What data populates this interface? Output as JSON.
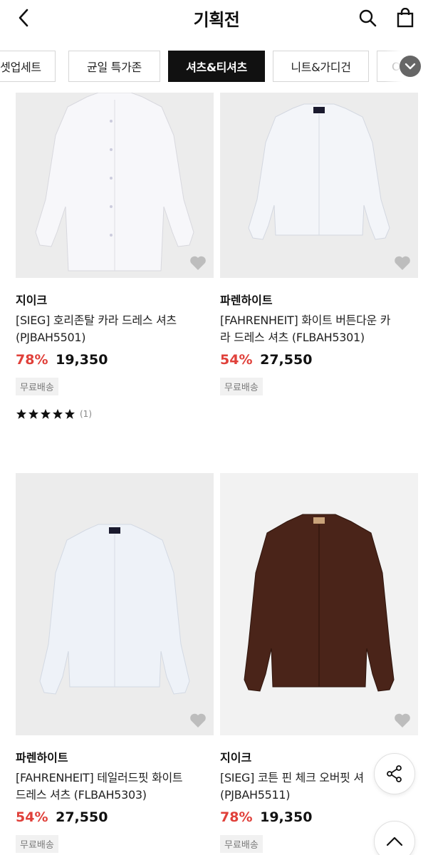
{
  "header": {
    "title": "기획전",
    "back_icon": "chevron-left-icon",
    "search_icon": "search-icon",
    "bag_icon": "shopping-bag-icon"
  },
  "tabs": [
    {
      "label": "셋업세트",
      "active": false
    },
    {
      "label": "균일 특가존",
      "active": false
    },
    {
      "label": "셔츠&티셔츠",
      "active": true
    },
    {
      "label": "니트&가디건",
      "active": false
    },
    {
      "label": "O",
      "active": false
    }
  ],
  "expand_icon": "chevron-down-icon",
  "products": [
    {
      "brand": "지이크",
      "name_line1": "[SIEG] 호리존탈 카라 드레스 셔츠",
      "name_line2": "(PJBAH5501)",
      "discount": "78%",
      "price": "19,350",
      "badge": "무료배송",
      "rating_stars": 5,
      "rating_count": "(1)",
      "shirt_color": "#f3f4f7"
    },
    {
      "brand": "파렌하이트",
      "name_line1": "[FAHRENHEIT] 화이트 버튼다운 카",
      "name_line2": "라 드레스 셔츠 (FLBAH5301)",
      "discount": "54%",
      "price": "27,550",
      "badge": "무료배송",
      "shirt_color": "#eef1f6"
    },
    {
      "brand": "파렌하이트",
      "name_line1": "[FAHRENHEIT] 테일러드핏 화이트",
      "name_line2": "드레스 셔츠 (FLBAH5303)",
      "discount": "54%",
      "price": "27,550",
      "badge": "무료배송",
      "shirt_color": "#e9eef6"
    },
    {
      "brand": "지이크",
      "name_line1": "[SIEG] 코튼 핀 체크 오버핏 셔",
      "name_line2": "(PJBAH5511)",
      "discount": "78%",
      "price": "19,350",
      "badge": "무료배송",
      "shirt_color": "#4a2419"
    }
  ],
  "colors": {
    "accent_discount": "#e0403a",
    "active_tab_bg": "#111111"
  },
  "floating": {
    "share_icon": "share-icon",
    "top_icon": "chevron-up-icon"
  }
}
